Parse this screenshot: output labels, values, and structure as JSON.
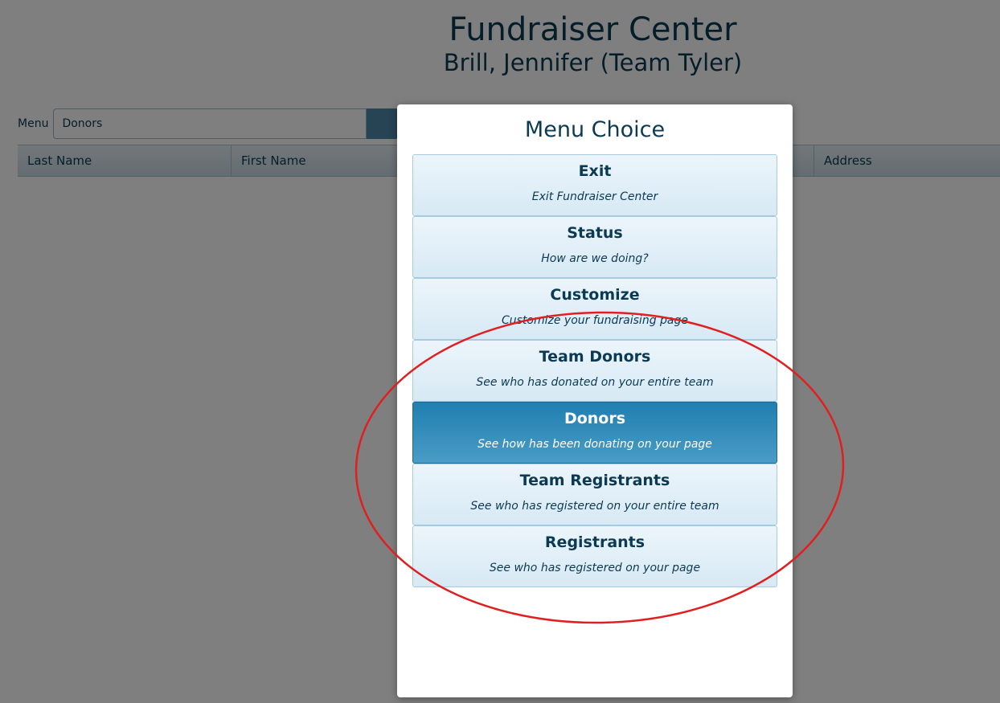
{
  "header": {
    "title": "Fundraiser Center",
    "subtitle": "Brill, Jennifer (Team Tyler)"
  },
  "menu": {
    "label": "Menu",
    "selected": "Donors"
  },
  "table": {
    "columns": [
      "Last Name",
      "First Name",
      "",
      "Address"
    ]
  },
  "modal": {
    "title": "Menu Choice",
    "choices": [
      {
        "title": "Exit",
        "desc": "Exit Fundraiser Center",
        "active": false
      },
      {
        "title": "Status",
        "desc": "How are we doing?",
        "active": false
      },
      {
        "title": "Customize",
        "desc": "Customize your fundraising page",
        "active": false
      },
      {
        "title": "Team Donors",
        "desc": "See who has donated on your entire team",
        "active": false
      },
      {
        "title": "Donors",
        "desc": "See how has been donating on your page",
        "active": true
      },
      {
        "title": "Team Registrants",
        "desc": "See who has registered on your entire team",
        "active": false
      },
      {
        "title": "Registrants",
        "desc": "See who has registered on your page",
        "active": false
      }
    ]
  },
  "colors": {
    "brand_text": "#0b3a52",
    "active_choice": "#1f7fb0",
    "annotation_circle": "#e02020"
  }
}
